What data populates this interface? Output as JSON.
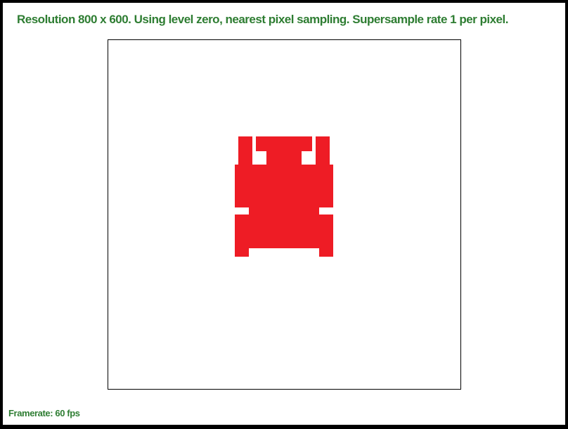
{
  "status": {
    "text": "Resolution 800 x 600. Using level zero, nearest pixel sampling. Supersample rate 1 per pixel."
  },
  "framerate": {
    "text": "Framerate: 60 fps"
  },
  "colors": {
    "text": "#2e7d32",
    "sprite": "#ee1c25",
    "canvas_background": "#ffffff",
    "window_border": "#000000"
  },
  "sprite": {
    "name": "red-pixel-sprite"
  }
}
